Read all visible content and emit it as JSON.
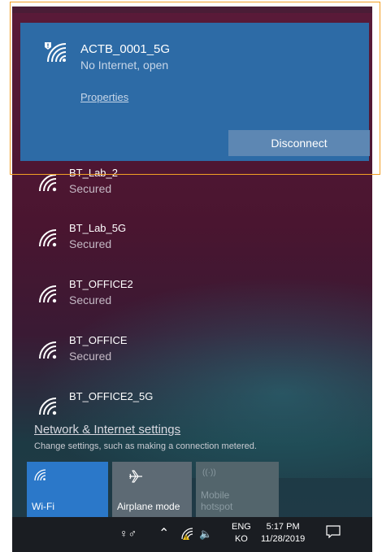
{
  "active_network": {
    "ssid": "ACTB_0001_5G",
    "status": "No Internet, open",
    "properties_label": "Properties",
    "disconnect_label": "Disconnect",
    "icon": "wifi-warning-icon"
  },
  "networks": [
    {
      "ssid": "BT_Lab_2",
      "status": "Secured",
      "icon": "wifi-icon"
    },
    {
      "ssid": "BT_Lab_5G",
      "status": "Secured",
      "icon": "wifi-icon"
    },
    {
      "ssid": "BT_OFFICE2",
      "status": "Secured",
      "icon": "wifi-icon"
    },
    {
      "ssid": "BT_OFFICE",
      "status": "Secured",
      "icon": "wifi-icon"
    },
    {
      "ssid": "BT_OFFICE2_5G",
      "status": "",
      "icon": "wifi-icon"
    }
  ],
  "settings": {
    "link": "Network & Internet settings",
    "description": "Change settings, such as making a connection metered."
  },
  "quick_actions": [
    {
      "label": "Wi-Fi",
      "icon": "wifi-icon",
      "state": "on"
    },
    {
      "label": "Airplane mode",
      "icon": "airplane-icon",
      "state": "off"
    },
    {
      "label": "Mobile\nhotspot",
      "icon": "hotspot-icon",
      "state": "disabled"
    }
  ],
  "taskbar": {
    "language_top": "ENG",
    "language_bottom": "KO",
    "time": "5:17 PM",
    "date": "11/28/2019"
  },
  "colors": {
    "accent": "#2b78c9",
    "active_bg": "#2d6ba6",
    "highlight": "#f2a024"
  }
}
